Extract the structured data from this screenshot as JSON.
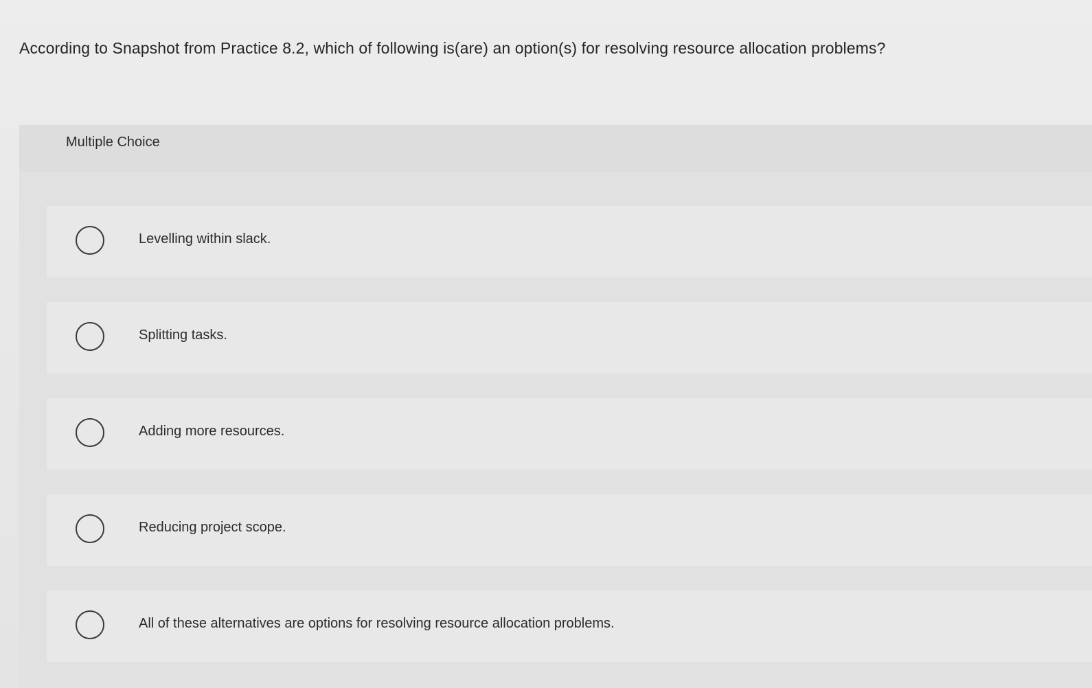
{
  "question": {
    "text": "According to Snapshot from Practice 8.2, which of following is(are) an option(s) for resolving resource allocation problems?"
  },
  "panel": {
    "header_label": "Multiple Choice"
  },
  "options": [
    {
      "label": "Levelling within slack."
    },
    {
      "label": "Splitting tasks."
    },
    {
      "label": "Adding more resources."
    },
    {
      "label": "Reducing project scope."
    },
    {
      "label": "All of these alternatives are options for resolving resource allocation problems."
    }
  ]
}
